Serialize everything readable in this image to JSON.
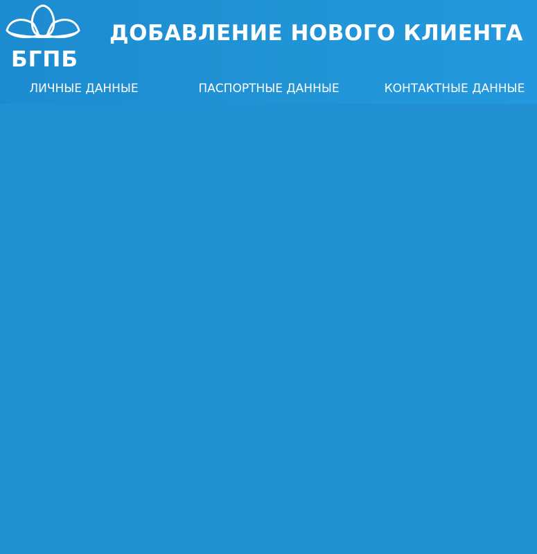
{
  "logo": {
    "icon": "bank-lotus-logo",
    "text": "БГПБ"
  },
  "header": {
    "title": "ДОБАВЛЕНИЕ НОВОГО КЛИЕНТА"
  },
  "tabs": [
    {
      "label": "ЛИЧНЫЕ ДАННЫЕ"
    },
    {
      "label": "ПАСПОРТНЫЕ ДАННЫЕ"
    },
    {
      "label": "КОНТАКТНЫЕ ДАННЫЕ"
    }
  ],
  "colors": {
    "background": "#2190d2",
    "text": "#ffffff"
  }
}
